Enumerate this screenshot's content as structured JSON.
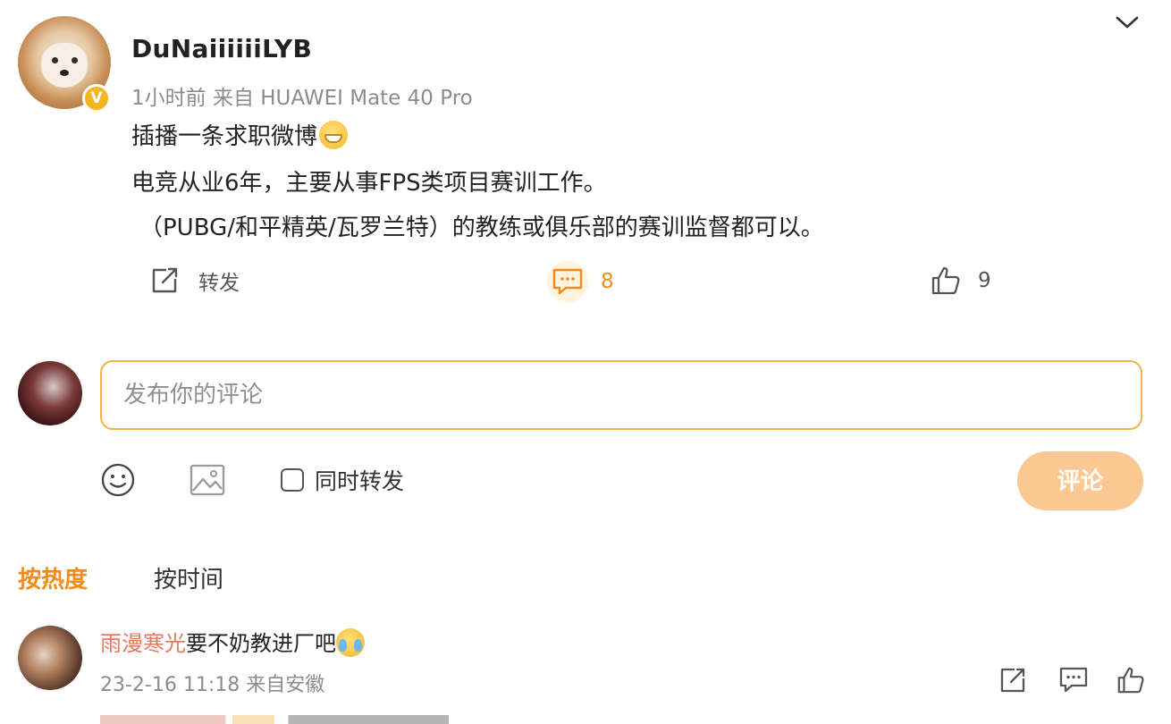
{
  "post": {
    "username": "DuNaiiiiiiLYB",
    "verified_badge": "V",
    "meta": "1小时前  来自 HUAWEI Mate 40 Pro",
    "line1": "插播一条求职微博",
    "line2": "电竞从业6年，主要从事FPS类项目赛训工作。",
    "line3": "（PUBG/和平精英/瓦罗兰特）的教练或俱乐部的赛训监督都可以。",
    "actions": {
      "repost_label": "转发",
      "comment_count": "8",
      "like_count": "9"
    },
    "icons": [
      "chevron-down-icon",
      "grin-emoji-icon",
      "repost-icon",
      "comment-icon",
      "like-icon"
    ]
  },
  "composer": {
    "placeholder": "发布你的评论",
    "also_repost_label": "同时转发",
    "submit_label": "评论",
    "icons": [
      "smile-icon",
      "image-icon"
    ]
  },
  "sort": {
    "hot_label": "按热度",
    "time_label": "按时间"
  },
  "comments": [
    {
      "user": "雨漫寒光",
      "text": "要不奶教进厂吧",
      "meta": "23-2-16 11:18 来自安徽",
      "icons": [
        "cry-laugh-emoji-icon",
        "repost-icon",
        "comment-icon",
        "like-icon"
      ]
    }
  ],
  "colors": {
    "accent": "#f08c1c",
    "input_border": "#f5b04a",
    "submit_bg": "#fbc792",
    "comment_user": "#e07a5f",
    "meta_gray": "#8c8c8c"
  }
}
